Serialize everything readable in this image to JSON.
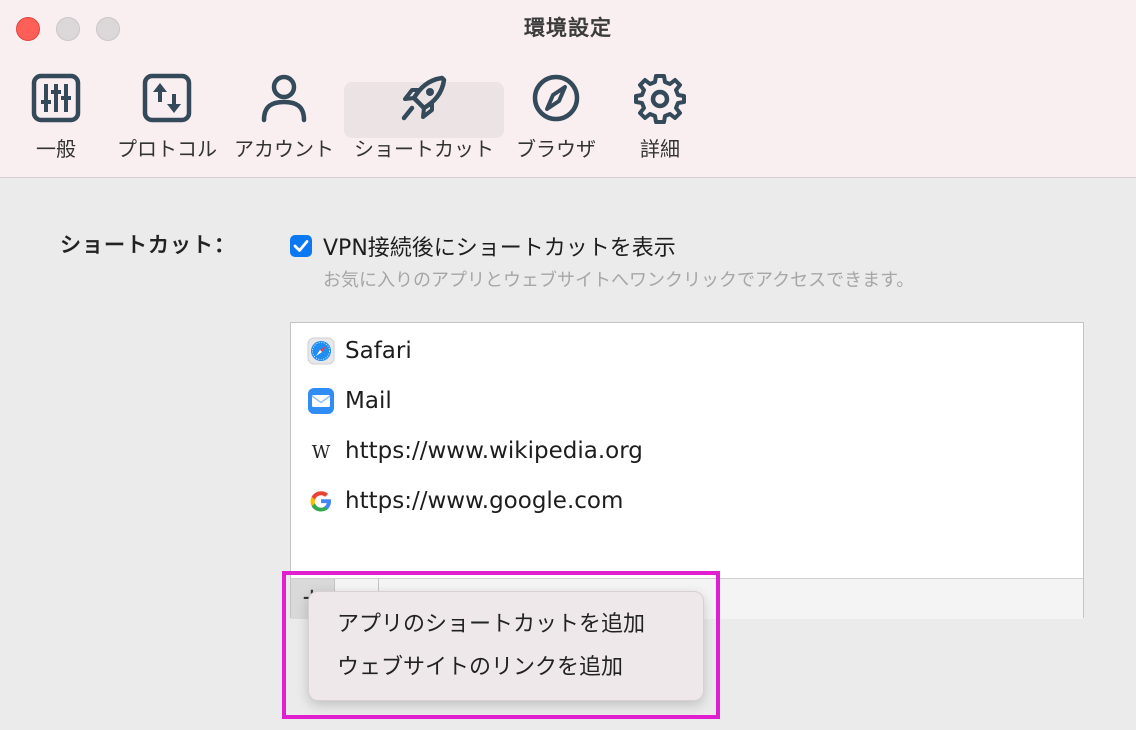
{
  "window": {
    "title": "環境設定"
  },
  "toolbar": {
    "tabs": [
      {
        "label": "一般",
        "icon": "sliders-icon",
        "selected": false
      },
      {
        "label": "プロトコル",
        "icon": "protocol-arrows-icon",
        "selected": false
      },
      {
        "label": "アカウント",
        "icon": "person-icon",
        "selected": false
      },
      {
        "label": "ショートカット",
        "icon": "rocket-icon",
        "selected": true
      },
      {
        "label": "ブラウザ",
        "icon": "compass-icon",
        "selected": false
      },
      {
        "label": "詳細",
        "icon": "gear-icon",
        "selected": false
      }
    ]
  },
  "shortcuts": {
    "heading": "ショートカット：",
    "checkbox_label": "VPN接続後にショートカットを表示",
    "checkbox_checked": true,
    "description": "お気に入りのアプリとウェブサイトへワンクリックでアクセスできます。",
    "items": [
      {
        "label": "Safari",
        "icon": "safari-icon"
      },
      {
        "label": "Mail",
        "icon": "mail-icon"
      },
      {
        "label": "https://www.wikipedia.org",
        "icon": "wikipedia-icon"
      },
      {
        "label": "https://www.google.com",
        "icon": "google-icon"
      }
    ],
    "add_button": "+"
  },
  "menu": {
    "items": [
      {
        "label": "アプリのショートカットを追加"
      },
      {
        "label": "ウェブサイトのリンクを追加"
      }
    ]
  },
  "colors": {
    "accent": "#0a77f3",
    "highlight": "#e020d0",
    "close": "#fe5f57"
  }
}
